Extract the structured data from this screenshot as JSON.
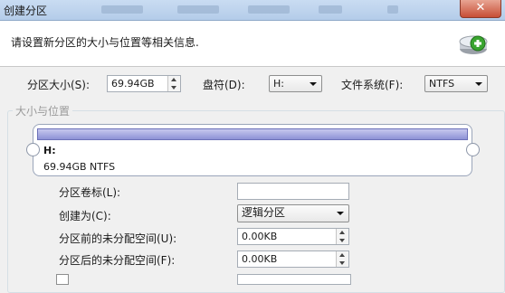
{
  "window": {
    "title": "创建分区",
    "close_glyph": "✕"
  },
  "header": {
    "description": "请设置新分区的大小与位置等相关信息."
  },
  "form_top": {
    "size_label": "分区大小(S):",
    "size_value": "69.94GB",
    "drive_label": "盘符(D):",
    "drive_value": "H:",
    "fs_label": "文件系统(F):",
    "fs_value": "NTFS"
  },
  "group": {
    "legend": "大小与位置"
  },
  "preview": {
    "drive": "H:",
    "size": "69.94GB NTFS"
  },
  "form_rows": [
    {
      "label": "分区卷标(L):",
      "value": ""
    },
    {
      "label": "创建为(C):",
      "value": "逻辑分区"
    },
    {
      "label": "分区前的未分配空间(U):",
      "value": "0.00KB"
    },
    {
      "label": "分区后的未分配空间(F):",
      "value": "0.00KB"
    }
  ],
  "colors": {
    "accent": "#8d92d6",
    "titlebar": "#b4cce9",
    "close": "#c74e36"
  },
  "icons": [
    "add-partition-icon",
    "close-icon",
    "chevron-down-icon",
    "spin-up-icon",
    "spin-down-icon"
  ]
}
